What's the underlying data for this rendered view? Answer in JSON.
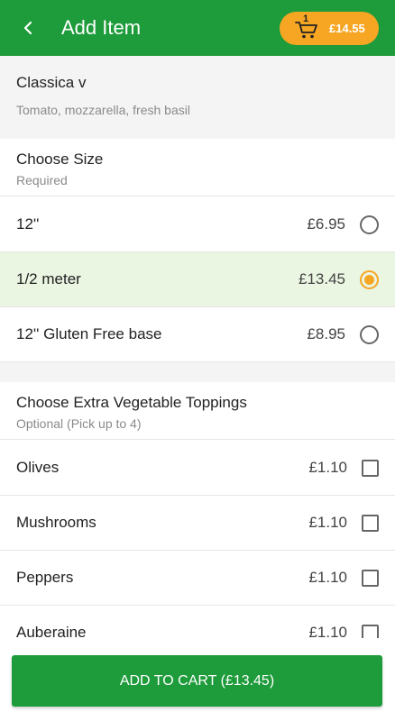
{
  "header": {
    "title": "Add Item",
    "back_icon": "chevron-left-icon",
    "cart": {
      "count": "1",
      "total": "£14.55",
      "icon": "cart-icon"
    }
  },
  "product": {
    "name": "Classica v",
    "description": "Tomato, mozzarella, fresh basil"
  },
  "size_section": {
    "title": "Choose Size",
    "subtitle": "Required",
    "options": [
      {
        "label": "12''",
        "price": "£6.95",
        "selected": false
      },
      {
        "label": "1/2 meter",
        "price": "£13.45",
        "selected": true
      },
      {
        "label": "12'' Gluten Free base",
        "price": "£8.95",
        "selected": false
      }
    ]
  },
  "toppings_section": {
    "title": "Choose Extra Vegetable Toppings",
    "subtitle": "Optional (Pick up to 4)",
    "options": [
      {
        "label": "Olives",
        "price": "£1.10",
        "checked": false
      },
      {
        "label": "Mushrooms",
        "price": "£1.10",
        "checked": false
      },
      {
        "label": "Peppers",
        "price": "£1.10",
        "checked": false
      },
      {
        "label": "Auberaine",
        "price": "£1.10",
        "checked": false
      }
    ]
  },
  "footer": {
    "add_to_cart_label": "ADD TO CART (£13.45)"
  },
  "colors": {
    "brand_green": "#1e9b3a",
    "accent_orange": "#f6a623",
    "selected_row": "#eaf5e2"
  }
}
